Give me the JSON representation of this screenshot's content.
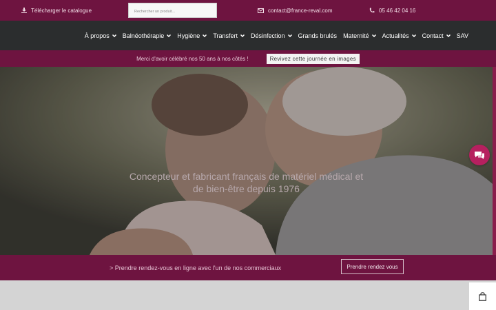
{
  "topbar": {
    "catalogue_label": "Télécharger le catalogue",
    "search_placeholder": "Rechercher un produit...",
    "email": "contact@france-reval.com",
    "phone": "05 46 42 04 16"
  },
  "nav": {
    "items": [
      {
        "label": "À propos",
        "dropdown": true
      },
      {
        "label": "Balnéothérapie",
        "dropdown": true
      },
      {
        "label": "Hygiène",
        "dropdown": true
      },
      {
        "label": "Transfert",
        "dropdown": true
      },
      {
        "label": "Désinfection",
        "dropdown": true
      },
      {
        "label": "Grands brulés",
        "dropdown": false
      },
      {
        "label": "Maternité",
        "dropdown": true
      },
      {
        "label": "Actualités",
        "dropdown": true
      },
      {
        "label": "Contact",
        "dropdown": true
      },
      {
        "label": "SAV",
        "dropdown": false
      }
    ]
  },
  "announcement": {
    "text": "Merci d'avoir célébré nos 50 ans à nos côtés !",
    "button_label": "Revivez cette journée en images"
  },
  "hero": {
    "title": "Concepteur et fabricant français de matériel médical et de bien-être depuis 1976"
  },
  "cta": {
    "text": "> Prendre rendez-vous en ligne avec l'un de nos commerciaux",
    "button_label": "Prendre rendez vous"
  },
  "icons": {
    "catalogue": "download-icon",
    "email": "envelope-icon",
    "phone": "phone-icon",
    "chat": "chat-icon",
    "cart": "shopping-bag-icon"
  },
  "colors": {
    "brand": "#6e1440",
    "nav_bg": "#2b2d2e",
    "chat_accent": "#b6205f"
  }
}
